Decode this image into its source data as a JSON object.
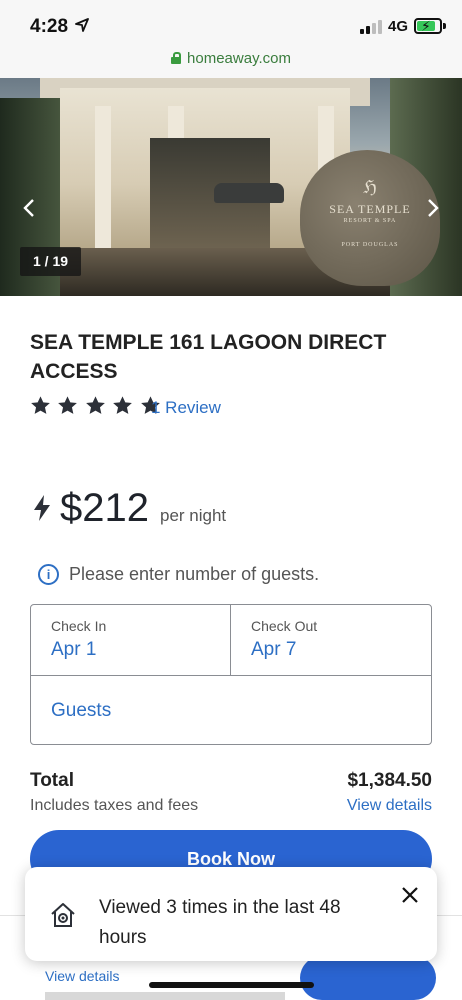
{
  "status": {
    "time": "4:28",
    "network": "4G"
  },
  "browser": {
    "url": "homeaway.com"
  },
  "hero": {
    "photo_counter": "1 / 19",
    "sign_mark": "ℌ",
    "sign_name": "SEA TEMPLE",
    "sign_sub": "RESORT & SPA",
    "sign_location": "PORT DOUGLAS"
  },
  "listing": {
    "title": "SEA TEMPLE 161 LAGOON DIRECT ACCESS",
    "rating_stars": 5,
    "review_link": "1 Review",
    "price": "$212",
    "price_unit": "per night",
    "guests_hint": "Please enter number of guests."
  },
  "booking": {
    "check_in_label": "Check In",
    "check_in_value": "Apr 1",
    "check_out_label": "Check Out",
    "check_out_value": "Apr 7",
    "guests_label": "Guests"
  },
  "total": {
    "label": "Total",
    "sublabel": "Includes taxes and fees",
    "amount": "$1,384.50",
    "details_link": "View details"
  },
  "actions": {
    "book_now": "Book Now"
  },
  "bottom_bar": {
    "details_link": "View details"
  },
  "toast": {
    "message": "Viewed 3 times in the last 48 hours"
  },
  "colors": {
    "accent": "#2d6fc4",
    "button": "#2a64d1",
    "url_green": "#3a7d3d"
  }
}
